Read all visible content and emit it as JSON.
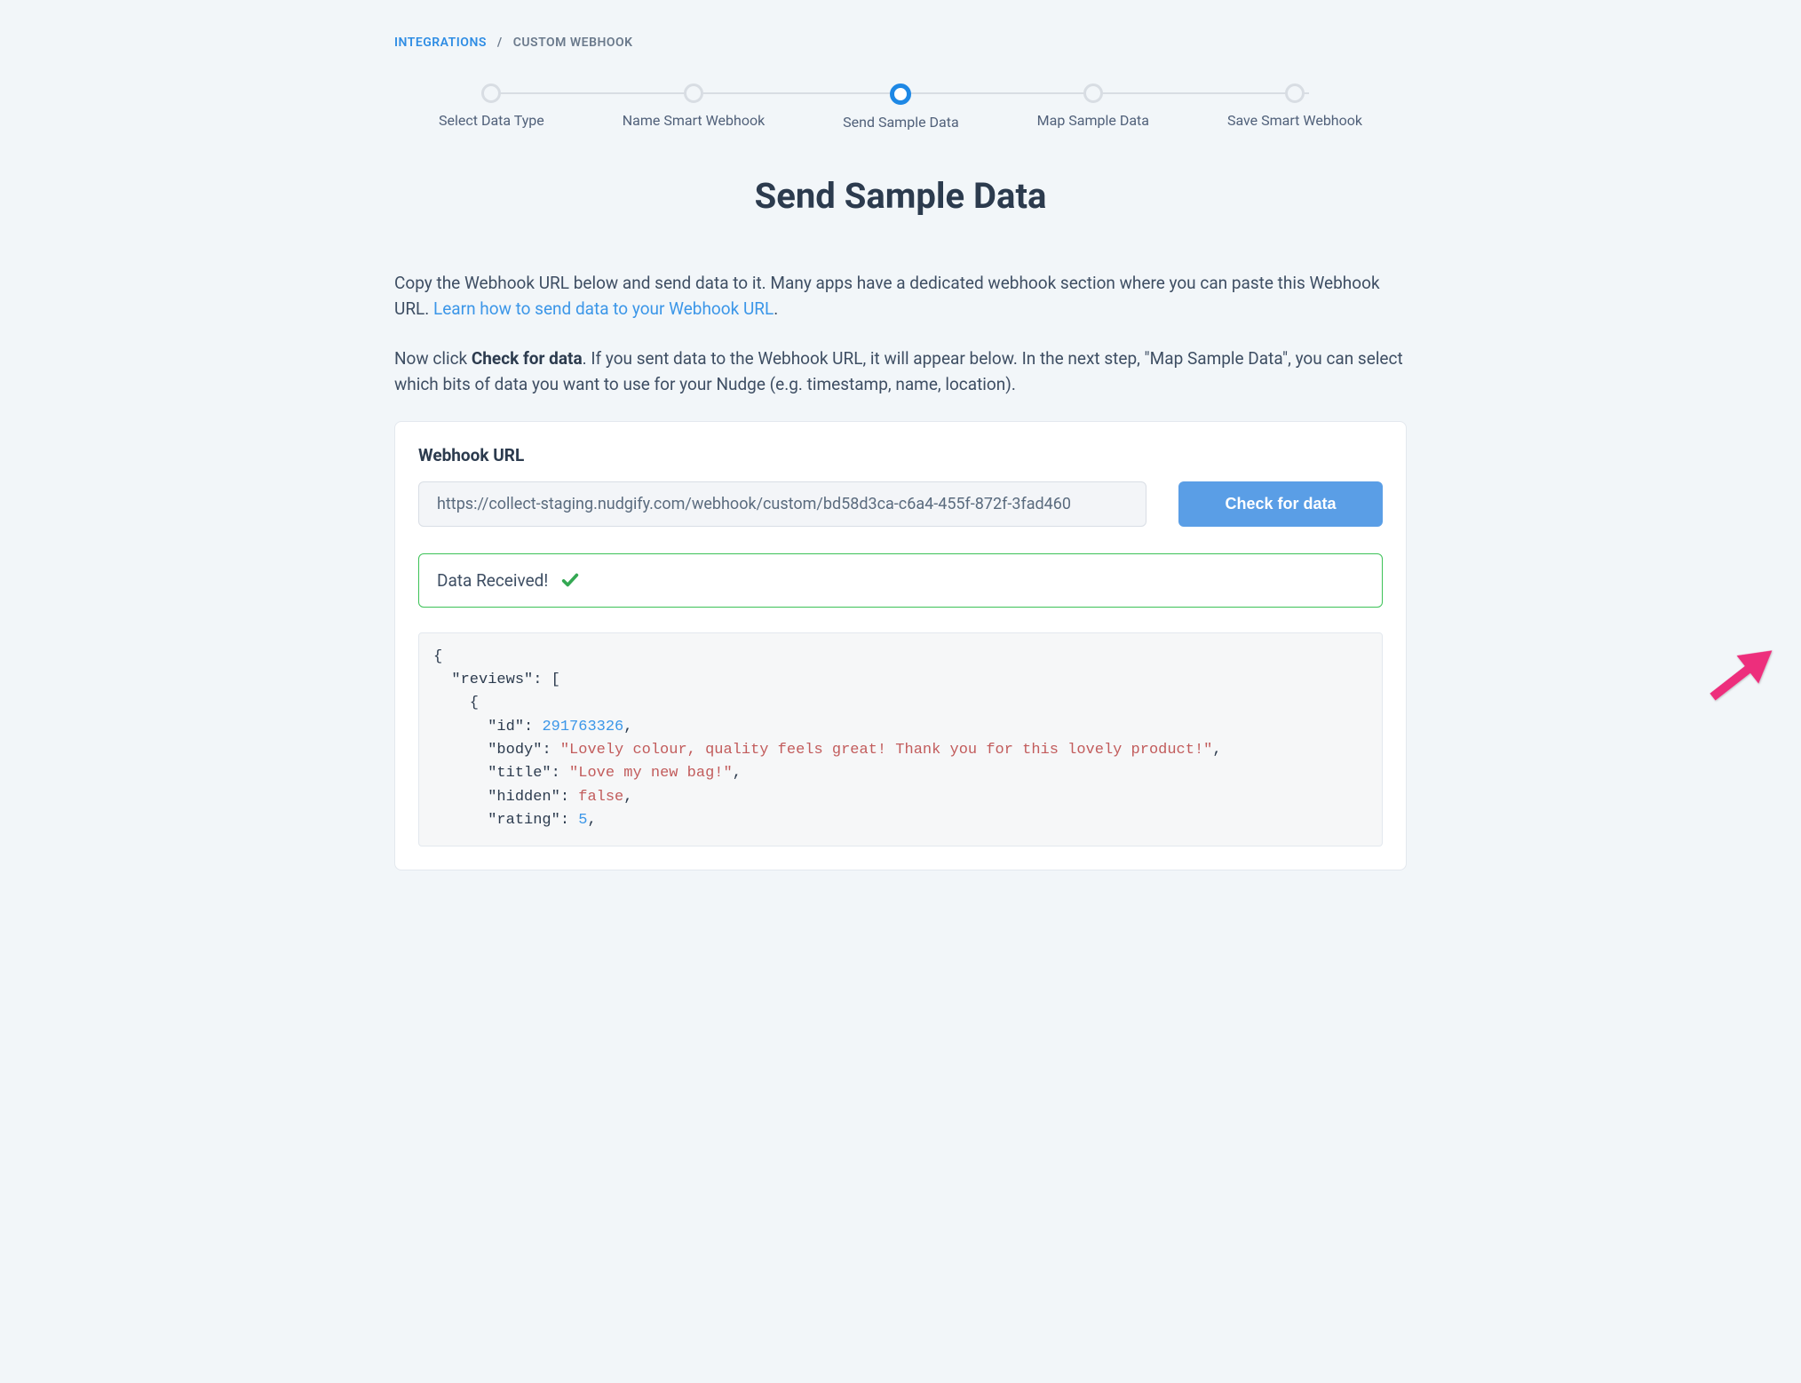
{
  "breadcrumb": {
    "root": "INTEGRATIONS",
    "current": "CUSTOM WEBHOOK"
  },
  "stepper": {
    "steps": [
      {
        "label": "Select Data Type"
      },
      {
        "label": "Name Smart Webhook"
      },
      {
        "label": "Send Sample Data"
      },
      {
        "label": "Map Sample Data"
      },
      {
        "label": "Save Smart Webhook"
      }
    ],
    "active_index": 2
  },
  "page_title": "Send Sample Data",
  "intro": {
    "p1_pre": "Copy the Webhook URL below and send data to it. Many apps have a dedicated webhook section where you can paste this Webhook URL. ",
    "p1_link": "Learn how to send data to your Webhook URL",
    "p1_post": ".",
    "p2_pre": "Now click ",
    "p2_strong": "Check for data",
    "p2_post": ". If you sent data to the Webhook URL, it will appear below. In the next step, \"Map Sample Data\", you can select which bits of data you want to use for your Nudge (e.g. timestamp, name, location)."
  },
  "card": {
    "url_label": "Webhook URL",
    "url_value": "https://collect-staging.nudgify.com/webhook/custom/bd58d3ca-c6a4-455f-872f-3fad460",
    "check_btn": "Check for data",
    "banner_text": "Data Received!"
  },
  "json_sample": {
    "lines": [
      [
        {
          "t": "{"
        }
      ],
      [
        {
          "t": "  "
        },
        {
          "t": "\"reviews\"",
          "c": "key"
        },
        {
          "t": ": ["
        }
      ],
      [
        {
          "t": "    {"
        }
      ],
      [
        {
          "t": "      "
        },
        {
          "t": "\"id\"",
          "c": "key"
        },
        {
          "t": ": "
        },
        {
          "t": "291763326",
          "c": "num"
        },
        {
          "t": ","
        }
      ],
      [
        {
          "t": "      "
        },
        {
          "t": "\"body\"",
          "c": "key"
        },
        {
          "t": ": "
        },
        {
          "t": "\"Lovely colour, quality feels great! Thank you for this lovely product!\"",
          "c": "str"
        },
        {
          "t": ","
        }
      ],
      [
        {
          "t": "      "
        },
        {
          "t": "\"title\"",
          "c": "key"
        },
        {
          "t": ": "
        },
        {
          "t": "\"Love my new bag!\"",
          "c": "str"
        },
        {
          "t": ","
        }
      ],
      [
        {
          "t": "      "
        },
        {
          "t": "\"hidden\"",
          "c": "key"
        },
        {
          "t": ": "
        },
        {
          "t": "false",
          "c": "bool"
        },
        {
          "t": ","
        }
      ],
      [
        {
          "t": "      "
        },
        {
          "t": "\"rating\"",
          "c": "key"
        },
        {
          "t": ": "
        },
        {
          "t": "5",
          "c": "num"
        },
        {
          "t": ","
        }
      ]
    ]
  }
}
